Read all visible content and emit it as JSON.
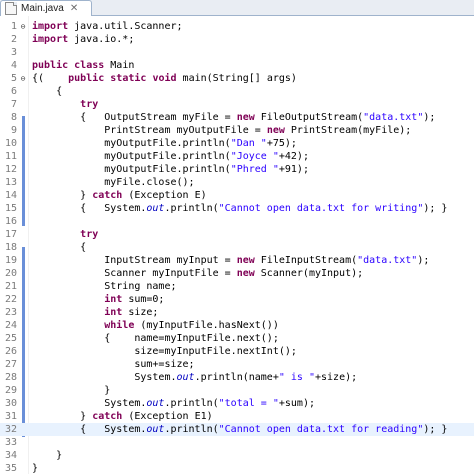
{
  "tab": {
    "label": "Main.java",
    "close": "✕",
    "icon": "java-file-icon"
  },
  "colors": {
    "keyword": "#7f0055",
    "string": "#2a00ff",
    "static_field": "#0000c0",
    "line_number": "#7b7b7b",
    "current_line": "#e8f2fe"
  },
  "current_line": 32,
  "lines": [
    {
      "n": "1",
      "fold": "⊖",
      "tokens": [
        [
          "kw",
          "import"
        ],
        [
          "t",
          " java.util.Scanner;"
        ]
      ]
    },
    {
      "n": "2",
      "tokens": [
        [
          "kw",
          "import"
        ],
        [
          "t",
          " java.io.*;"
        ]
      ]
    },
    {
      "n": "3",
      "tokens": []
    },
    {
      "n": "4",
      "tokens": [
        [
          "kw",
          "public"
        ],
        [
          "t",
          " "
        ],
        [
          "kw",
          "class"
        ],
        [
          "t",
          " Main"
        ]
      ]
    },
    {
      "n": "5",
      "fold": "⊖",
      "tokens": [
        [
          "t",
          "{(    "
        ],
        [
          "kw",
          "public"
        ],
        [
          "t",
          " "
        ],
        [
          "kw",
          "static"
        ],
        [
          "t",
          " "
        ],
        [
          "kw",
          "void"
        ],
        [
          "t",
          " main(String[] args)"
        ]
      ]
    },
    {
      "n": "6",
      "tokens": [
        [
          "t",
          "    {"
        ]
      ]
    },
    {
      "n": "7",
      "tokens": [
        [
          "t",
          "        "
        ],
        [
          "kw",
          "try"
        ]
      ]
    },
    {
      "n": "8",
      "tokens": [
        [
          "t",
          "        {   OutputStream myFile = "
        ],
        [
          "kw",
          "new"
        ],
        [
          "t",
          " FileOutputStream("
        ],
        [
          "str",
          "\"data.txt\""
        ],
        [
          "t",
          ");"
        ]
      ]
    },
    {
      "n": "9",
      "tokens": [
        [
          "t",
          "            PrintStream myOutputFile = "
        ],
        [
          "kw",
          "new"
        ],
        [
          "t",
          " PrintStream(myFile);"
        ]
      ]
    },
    {
      "n": "10",
      "tokens": [
        [
          "t",
          "            myOutputFile.println("
        ],
        [
          "str",
          "\"Dan \""
        ],
        [
          "t",
          "+75);"
        ]
      ]
    },
    {
      "n": "11",
      "tokens": [
        [
          "t",
          "            myOutputFile.println("
        ],
        [
          "str",
          "\"Joyce \""
        ],
        [
          "t",
          "+42);"
        ]
      ]
    },
    {
      "n": "12",
      "tokens": [
        [
          "t",
          "            myOutputFile.println("
        ],
        [
          "str",
          "\"Phred \""
        ],
        [
          "t",
          "+91);"
        ]
      ]
    },
    {
      "n": "13",
      "tokens": [
        [
          "t",
          "            myFile.close();"
        ]
      ]
    },
    {
      "n": "14",
      "tokens": [
        [
          "t",
          "        } "
        ],
        [
          "kw",
          "catch"
        ],
        [
          "t",
          " (Exception E)"
        ]
      ]
    },
    {
      "n": "15",
      "tokens": [
        [
          "t",
          "        {   System."
        ],
        [
          "fld",
          "out"
        ],
        [
          "t",
          ".println("
        ],
        [
          "str",
          "\"Cannot open data.txt for writing\""
        ],
        [
          "t",
          "); }"
        ]
      ]
    },
    {
      "n": "16",
      "tokens": []
    },
    {
      "n": "17",
      "tokens": [
        [
          "t",
          "        "
        ],
        [
          "kw",
          "try"
        ]
      ]
    },
    {
      "n": "18",
      "tokens": [
        [
          "t",
          "        {"
        ]
      ]
    },
    {
      "n": "19",
      "tokens": [
        [
          "t",
          "            InputStream myInput = "
        ],
        [
          "kw",
          "new"
        ],
        [
          "t",
          " FileInputStream("
        ],
        [
          "str",
          "\"data.txt\""
        ],
        [
          "t",
          ");"
        ]
      ]
    },
    {
      "n": "20",
      "tokens": [
        [
          "t",
          "            Scanner myInputFile = "
        ],
        [
          "kw",
          "new"
        ],
        [
          "t",
          " Scanner(myInput);"
        ]
      ]
    },
    {
      "n": "21",
      "tokens": [
        [
          "t",
          "            String name;"
        ]
      ]
    },
    {
      "n": "22",
      "tokens": [
        [
          "t",
          "            "
        ],
        [
          "kw",
          "int"
        ],
        [
          "t",
          " sum=0;"
        ]
      ]
    },
    {
      "n": "23",
      "tokens": [
        [
          "t",
          "            "
        ],
        [
          "kw",
          "int"
        ],
        [
          "t",
          " size;"
        ]
      ]
    },
    {
      "n": "24",
      "tokens": [
        [
          "t",
          "            "
        ],
        [
          "kw",
          "while"
        ],
        [
          "t",
          " (myInputFile.hasNext())"
        ]
      ]
    },
    {
      "n": "25",
      "tokens": [
        [
          "t",
          "            {    name=myInputFile.next();"
        ]
      ]
    },
    {
      "n": "26",
      "tokens": [
        [
          "t",
          "                 size=myInputFile.nextInt();"
        ]
      ]
    },
    {
      "n": "27",
      "tokens": [
        [
          "t",
          "                 sum+=size;"
        ]
      ]
    },
    {
      "n": "28",
      "tokens": [
        [
          "t",
          "                 System."
        ],
        [
          "fld",
          "out"
        ],
        [
          "t",
          ".println(name+"
        ],
        [
          "str",
          "\" is \""
        ],
        [
          "t",
          "+size);"
        ]
      ]
    },
    {
      "n": "29",
      "tokens": [
        [
          "t",
          "            }"
        ]
      ]
    },
    {
      "n": "30",
      "tokens": [
        [
          "t",
          "            System."
        ],
        [
          "fld",
          "out"
        ],
        [
          "t",
          ".println("
        ],
        [
          "str",
          "\"total = \""
        ],
        [
          "t",
          "+sum);"
        ]
      ]
    },
    {
      "n": "31",
      "tokens": [
        [
          "t",
          "        } "
        ],
        [
          "kw",
          "catch"
        ],
        [
          "t",
          " (Exception E1)"
        ]
      ]
    },
    {
      "n": "32",
      "tokens": [
        [
          "t",
          "        {   System."
        ],
        [
          "fld",
          "out"
        ],
        [
          "t",
          ".println("
        ],
        [
          "str",
          "\"Cannot open data.txt for reading\""
        ],
        [
          "t",
          "); }"
        ]
      ]
    },
    {
      "n": "33",
      "tokens": []
    },
    {
      "n": "34",
      "tokens": [
        [
          "t",
          "    }"
        ]
      ]
    },
    {
      "n": "35",
      "tokens": [
        [
          "t",
          "}"
        ]
      ]
    }
  ]
}
